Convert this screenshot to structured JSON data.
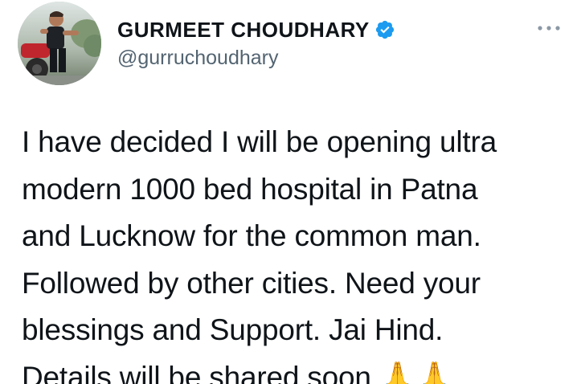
{
  "tweet": {
    "author": {
      "display_name": "GURMEET CHOUDHARY",
      "handle": "@gurruchoudhary",
      "verified_icon": "verified-badge-icon",
      "avatar_icon": "profile-photo"
    },
    "more_icon": "more-options-icon",
    "text_lines": [
      "I have decided I will be opening ultra",
      "modern 1000 bed hospital in Patna",
      "and Lucknow for the common man.",
      "Followed by other cities. Need your",
      "blessings and Support. Jai Hind.",
      "Details will be shared soon 🙏🙏"
    ]
  },
  "colors": {
    "verified_blue": "#1d9bf0",
    "text_primary": "#0f1419",
    "text_secondary": "#536471",
    "background": "#ffffff"
  }
}
